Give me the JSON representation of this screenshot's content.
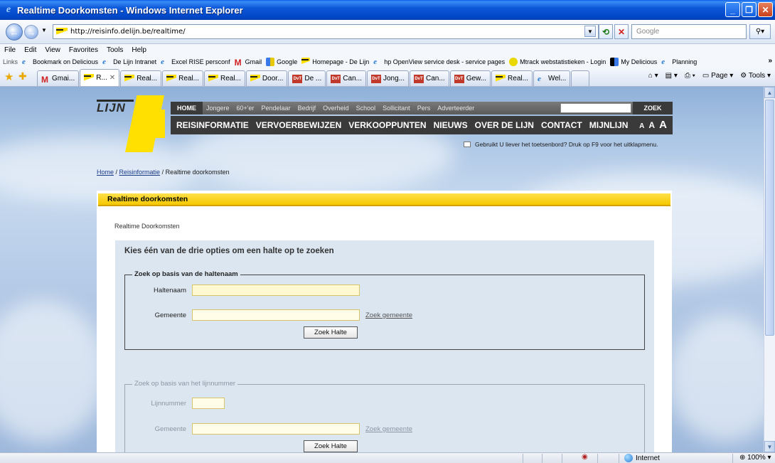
{
  "window": {
    "title": "Realtime Doorkomsten - Windows Internet Explorer"
  },
  "address": {
    "url": "http://reisinfo.delijn.be/realtime/",
    "search_placeholder": "Google"
  },
  "menu": [
    "File",
    "Edit",
    "View",
    "Favorites",
    "Tools",
    "Help"
  ],
  "links_bar": {
    "label": "Links",
    "items": [
      "Bookmark on Delicious",
      "De Lijn Intranet",
      "Excel RISE persconf",
      "Gmail",
      "Google",
      "Homepage - De Lijn",
      "hp OpenView service desk - service pages",
      "Mtrack webstatistieken - Login",
      "My Delicious",
      "Planning"
    ]
  },
  "tabs": [
    {
      "label": "Gmai...",
      "icon": "gmail-icon"
    },
    {
      "label": "R...",
      "icon": "lijn-icon",
      "active": true
    },
    {
      "label": "Real...",
      "icon": "lijn-icon"
    },
    {
      "label": "Real...",
      "icon": "lijn-icon"
    },
    {
      "label": "Real...",
      "icon": "lijn-icon"
    },
    {
      "label": "Door...",
      "icon": "lijn-icon"
    },
    {
      "label": "De ...",
      "icon": "dvt-icon"
    },
    {
      "label": "Can...",
      "icon": "dvt-icon"
    },
    {
      "label": "Jong...",
      "icon": "dvt-icon"
    },
    {
      "label": "Can...",
      "icon": "dvt-icon"
    },
    {
      "label": "Gew...",
      "icon": "dvt-icon"
    },
    {
      "label": "Real...",
      "icon": "lijn-icon"
    },
    {
      "label": "Wel...",
      "icon": "ie-icon"
    }
  ],
  "tab_tools": {
    "page": "Page",
    "tools": "Tools"
  },
  "site": {
    "logo_text": "LIJN",
    "topnav": [
      "Jongere",
      "60+'er",
      "Pendelaar",
      "Bedrijf",
      "Overheid",
      "School",
      "Sollicitant",
      "Pers",
      "Adverteerder"
    ],
    "home": "HOME",
    "search_button": "ZOEK",
    "mainnav": [
      "REISINFORMATIE",
      "VERVOERBEWIJZEN",
      "VERKOOPPUNTEN",
      "NIEUWS",
      "OVER DE LIJN",
      "CONTACT",
      "MIJNLIJN"
    ],
    "font_size": [
      "A",
      "A",
      "A"
    ],
    "keyboard_note": "Gebruikt U liever het toetsenbord? Druk op F9 voor het uitklapmenu.",
    "breadcrumb": {
      "home": "Home",
      "sep1": " / ",
      "reis": "Reisinformatie",
      "sep2": " / ",
      "current": "Realtime doorkomsten"
    }
  },
  "panel": {
    "header": "Realtime doorkomsten",
    "subtitle": "Realtime Doorkomsten",
    "options_title": "Kies één van de drie opties om een halte op te zoeken",
    "section1": {
      "legend": "Zoek op basis van de haltenaam",
      "haltenaam_label": "Haltenaam",
      "gemeente_label": "Gemeente",
      "zoek_gemeente": "Zoek gemeente",
      "button": "Zoek Halte"
    },
    "section2": {
      "legend": "Zoek op basis van het lijnnummer",
      "lijnnummer_label": "Lijnnummer",
      "gemeente_label": "Gemeente",
      "zoek_gemeente": "Zoek gemeente",
      "button": "Zoek Halte"
    }
  },
  "status": {
    "zone": "Internet",
    "zoom": "100%"
  }
}
